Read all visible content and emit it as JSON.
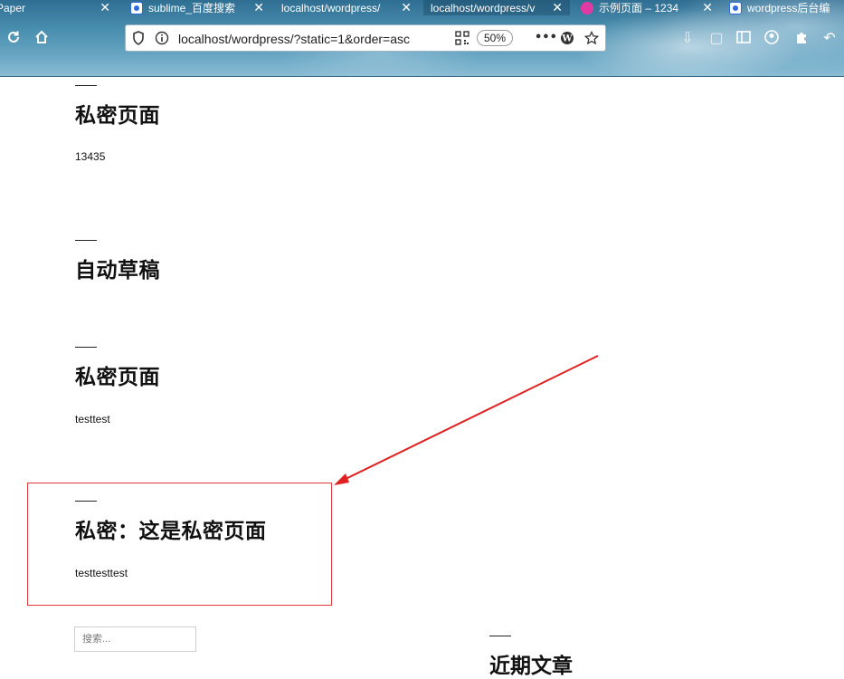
{
  "browser": {
    "tabs": [
      {
        "label": "Paper",
        "icon": "none"
      },
      {
        "label": "sublime_百度搜索",
        "icon": "baidu-icon"
      },
      {
        "label": "localhost/wordpress/",
        "icon": "none"
      },
      {
        "label": "localhost/wordpress/v",
        "icon": "none"
      },
      {
        "label": "示例页面 – 1234",
        "icon": "pink-circle-icon"
      },
      {
        "label": "wordpress后台编",
        "icon": "baidu-icon"
      }
    ],
    "url": "localhost/wordpress/?static=1&order=asc",
    "zoom": "50%"
  },
  "posts": [
    {
      "title": "私密页面",
      "excerpt": "13435"
    },
    {
      "title": "自动草稿",
      "excerpt": ""
    },
    {
      "title": "私密页面",
      "excerpt": "testtest"
    },
    {
      "title": "私密：这是私密页面",
      "excerpt": "testtesttest"
    }
  ],
  "search": {
    "placeholder": "搜索..."
  },
  "sidebar": {
    "widget_title": "近期文章"
  },
  "annotation": {
    "color": "#e02020"
  }
}
